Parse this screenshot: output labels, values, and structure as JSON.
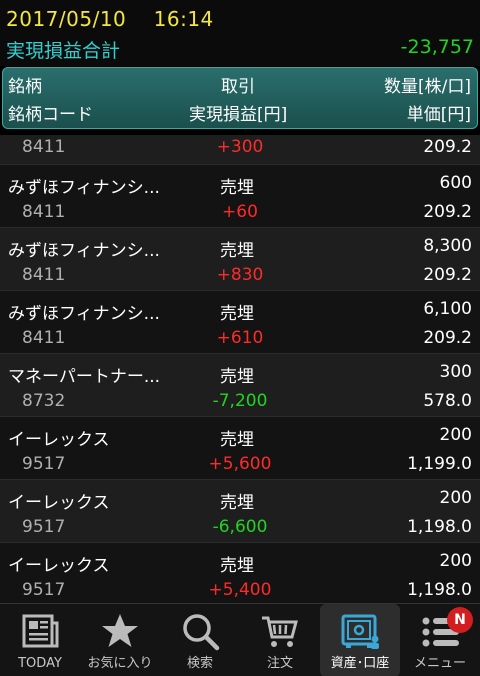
{
  "status": {
    "datetime": "2017/05/10　 16:14"
  },
  "summary": {
    "label": "実現損益合計",
    "value": "-23,757"
  },
  "header": {
    "col1_top": "銘柄",
    "col2_top": "取引",
    "col3_top": "数量[株/口]",
    "col1_bottom": "銘柄コード",
    "col2_bottom": "実現損益[円]",
    "col3_bottom": "単価[円]"
  },
  "partial_row": {
    "code": "8411",
    "pnl": "+300",
    "price": "209.2"
  },
  "rows": [
    {
      "name": "みずほフィナンシ...",
      "trade": "売埋",
      "qty": "600",
      "code": "8411",
      "pnl": "+60",
      "pnl_sign": "pos",
      "price": "209.2"
    },
    {
      "name": "みずほフィナンシ...",
      "trade": "売埋",
      "qty": "8,300",
      "code": "8411",
      "pnl": "+830",
      "pnl_sign": "pos",
      "price": "209.2"
    },
    {
      "name": "みずほフィナンシ...",
      "trade": "売埋",
      "qty": "6,100",
      "code": "8411",
      "pnl": "+610",
      "pnl_sign": "pos",
      "price": "209.2"
    },
    {
      "name": "マネーパートナー...",
      "trade": "売埋",
      "qty": "300",
      "code": "8732",
      "pnl": "-7,200",
      "pnl_sign": "neg",
      "price": "578.0"
    },
    {
      "name": "イーレックス",
      "trade": "売埋",
      "qty": "200",
      "code": "9517",
      "pnl": "+5,600",
      "pnl_sign": "pos",
      "price": "1,199.0"
    },
    {
      "name": "イーレックス",
      "trade": "売埋",
      "qty": "200",
      "code": "9517",
      "pnl": "-6,600",
      "pnl_sign": "neg",
      "price": "1,198.0"
    },
    {
      "name": "イーレックス",
      "trade": "売埋",
      "qty": "200",
      "code": "9517",
      "pnl": "+5,400",
      "pnl_sign": "pos",
      "price": "1,198.0"
    }
  ],
  "tabs": [
    {
      "label": "TODAY",
      "icon": "newspaper-icon"
    },
    {
      "label": "お気に入り",
      "icon": "star-icon"
    },
    {
      "label": "検索",
      "icon": "search-icon"
    },
    {
      "label": "注文",
      "icon": "cart-icon"
    },
    {
      "label": "資産･口座",
      "icon": "safe-icon",
      "active": true
    },
    {
      "label": "メニュー",
      "icon": "menu-icon"
    }
  ],
  "menu_badge": "N",
  "colors": {
    "positive": "#ff2a2a",
    "negative": "#22d422",
    "accent": "#2fd1d0",
    "date": "#f3e640"
  }
}
